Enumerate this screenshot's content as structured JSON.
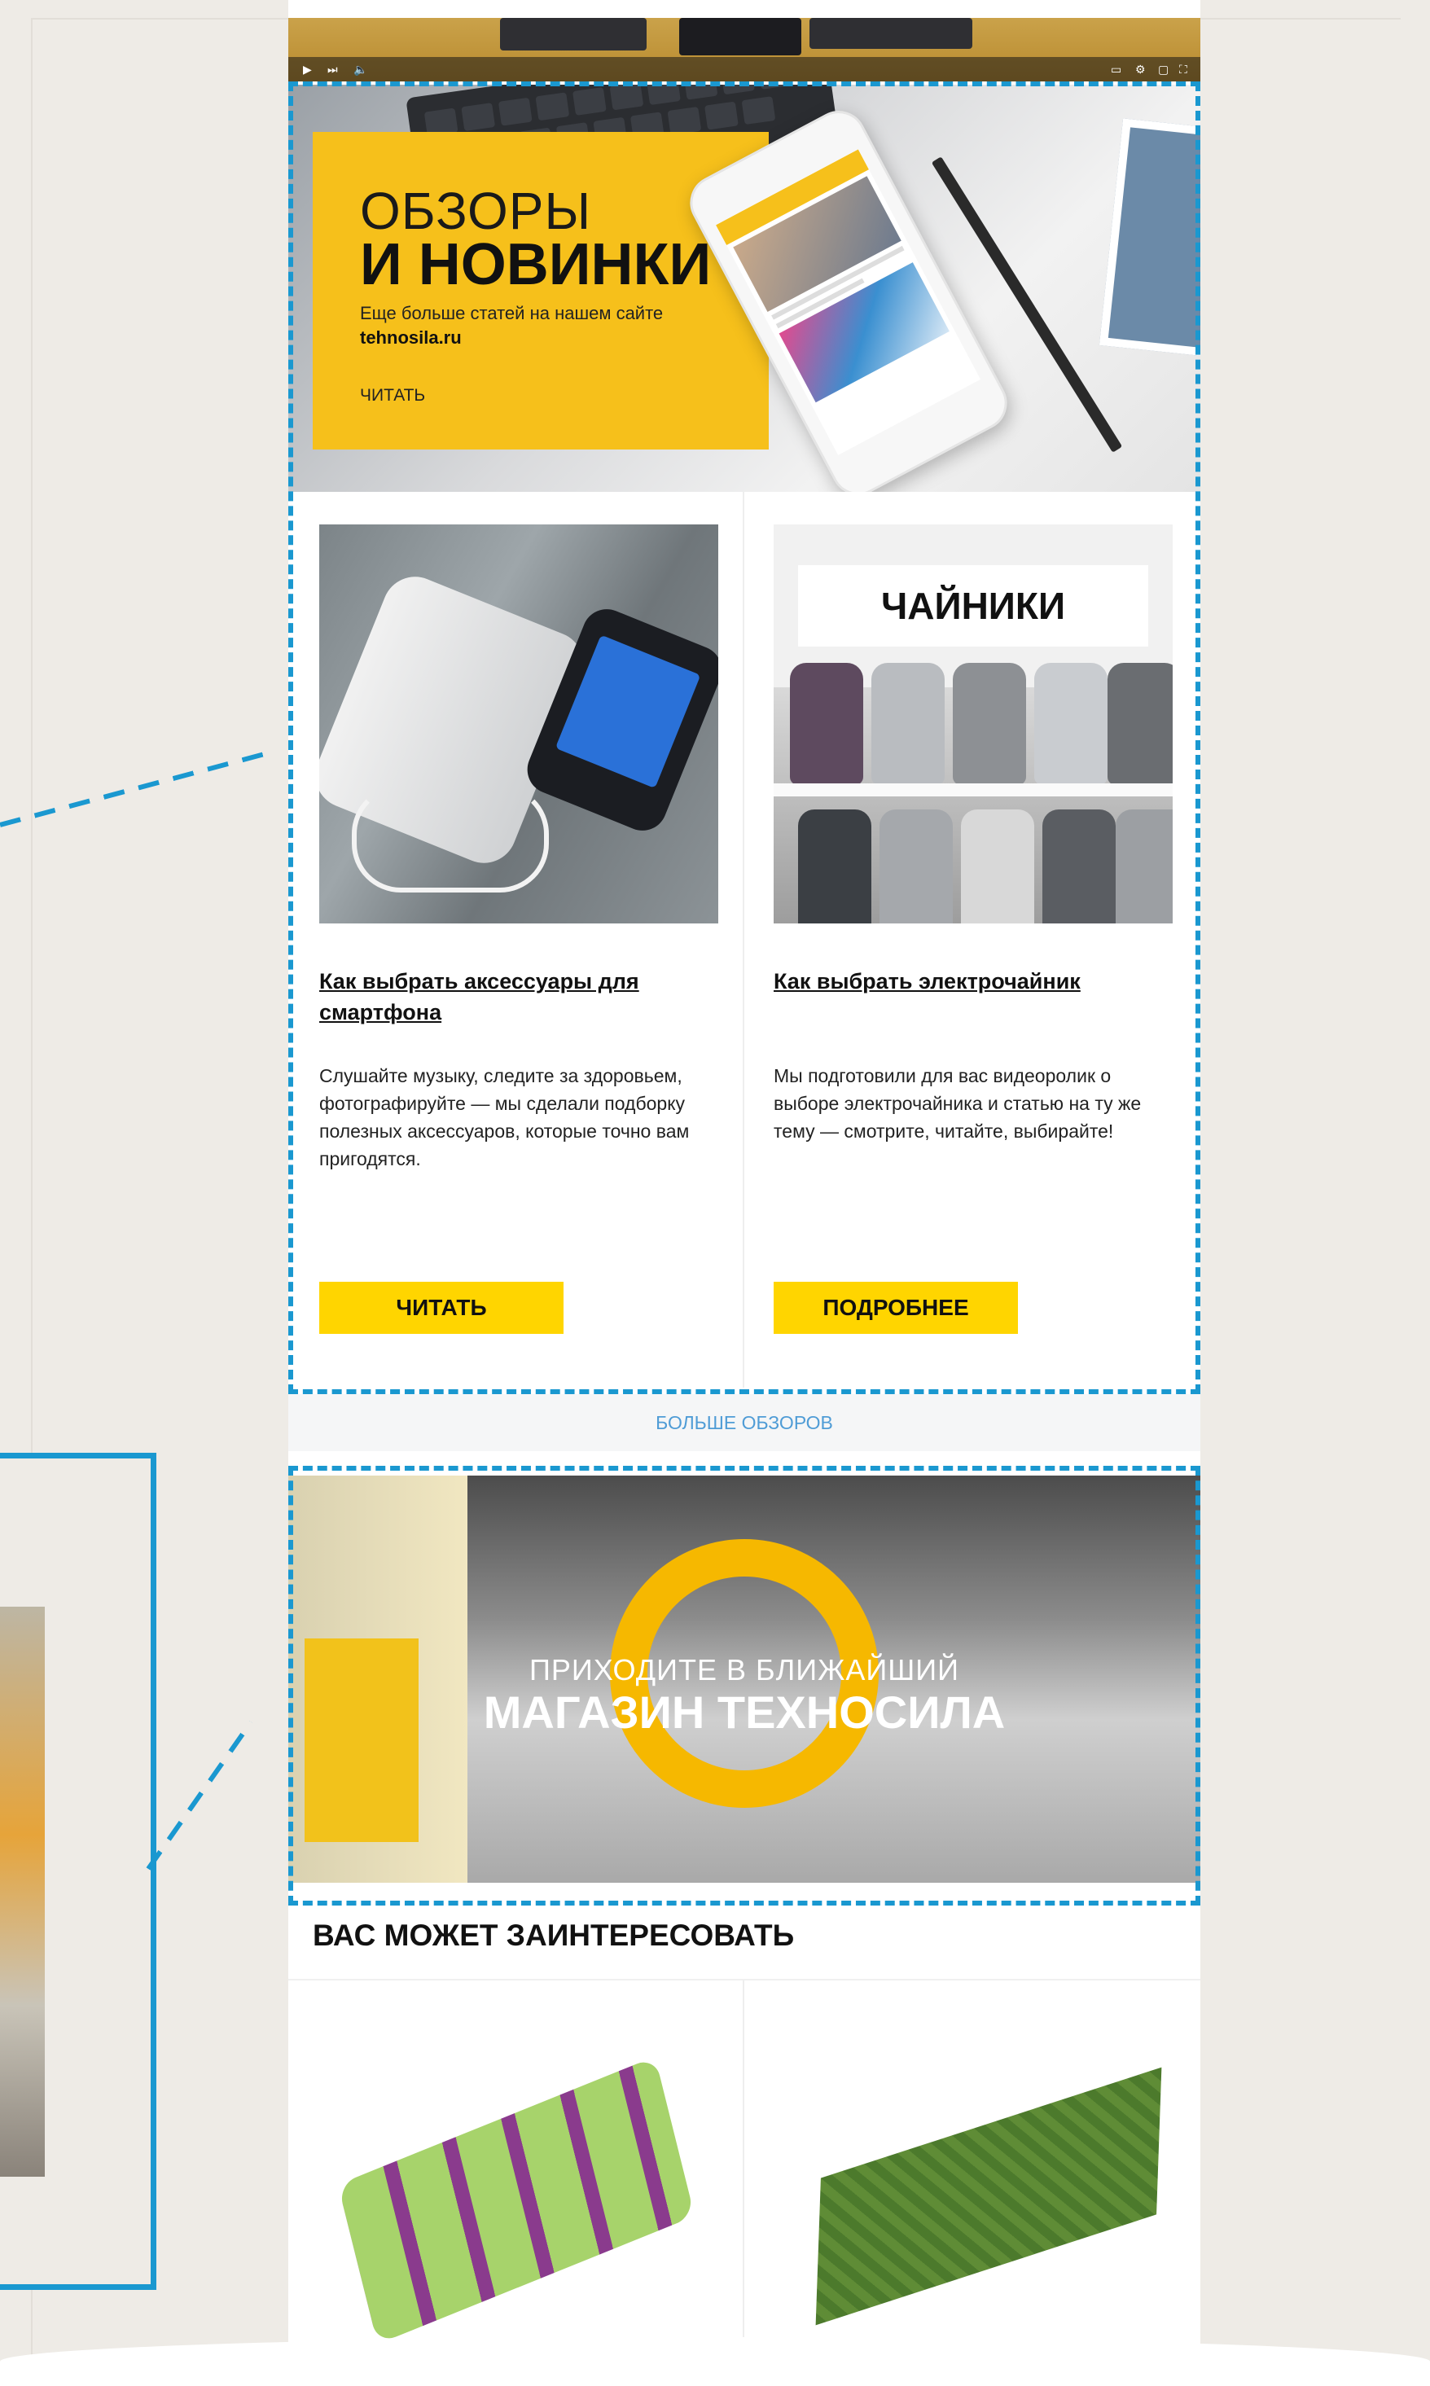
{
  "hero": {
    "title_line1": "ОБЗОРЫ",
    "title_line2": "И НОВИНКИ",
    "subtitle": "Еще больше статей на нашем сайте",
    "site": "tehnosila.ru",
    "cta": "ЧИТАТЬ"
  },
  "articles": [
    {
      "title": "Как выбрать аксессуары для смартфона",
      "description": "Слушайте музыку, следите за здоровьем, фотографируйте — мы сделали подборку полезных аксессуаров, которые точно вам пригодятся.",
      "button": "ЧИТАТЬ"
    },
    {
      "image_caption": "ЧАЙНИКИ",
      "title": "Как выбрать электрочайник",
      "description": "Мы подготовили для вас видеоролик о выборе электрочайника и статью на ту же тему — смотрите, читайте, выбирайте!",
      "button": "ПОДРОБНЕЕ"
    }
  ],
  "more_reviews": "БОЛЬШЕ ОБЗОРОВ",
  "store_banner": {
    "line1": "ПРИХОДИТЕ В БЛИЖАЙШИЙ",
    "line2": "МАГАЗИН ТЕХНОСИЛА"
  },
  "interest": {
    "title": "ВАС МОЖЕТ ЗАИНТЕРЕСОВАТЬ"
  },
  "colors": {
    "accent_yellow": "#ffd500",
    "highlight_blue": "#1a98d0",
    "link_blue": "#4f9cd6"
  }
}
